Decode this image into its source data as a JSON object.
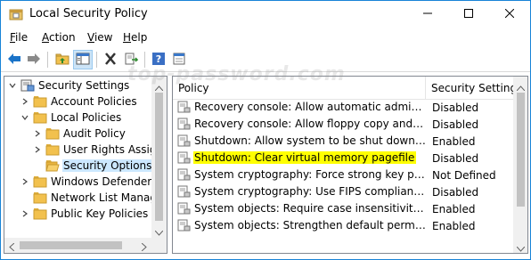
{
  "window": {
    "title": "Local Security Policy",
    "minimize_icon": "minimize-icon",
    "maximize_icon": "maximize-icon",
    "close_icon": "close-icon"
  },
  "menu": [
    {
      "label_ul": "F",
      "label_rest": "ile"
    },
    {
      "label_ul": "A",
      "label_rest": "ction"
    },
    {
      "label_ul": "V",
      "label_rest": "iew"
    },
    {
      "label_ul": "H",
      "label_rest": "elp"
    }
  ],
  "toolbar": {
    "buttons": [
      "back-icon",
      "forward-icon",
      "up-folder-icon",
      "show-hide-tree-icon",
      "delete-icon",
      "export-list-icon",
      "help-icon",
      "properties-icon"
    ]
  },
  "tree": {
    "items": [
      {
        "label": "Security Settings",
        "icon": "computer-policy-icon",
        "expanded": true
      },
      {
        "label": "Account Policies",
        "icon": "folder-icon",
        "expanded": false
      },
      {
        "label": "Local Policies",
        "icon": "folder-icon",
        "expanded": true
      },
      {
        "label": "Audit Policy",
        "icon": "folder-icon",
        "expanded": false
      },
      {
        "label": "User Rights Assignm",
        "icon": "folder-icon",
        "expanded": false
      },
      {
        "label": "Security Options",
        "icon": "folder-open-icon",
        "selected": true
      },
      {
        "label": "Windows Defender Fire",
        "icon": "folder-icon",
        "expanded": false
      },
      {
        "label": "Network List Manager P",
        "icon": "folder-icon"
      },
      {
        "label": "Public Key Policies",
        "icon": "folder-icon",
        "expanded": false
      }
    ]
  },
  "list": {
    "columns": [
      "Policy",
      "Security Setting"
    ],
    "rows": [
      {
        "policy": "Recovery console: Allow automatic administrati...",
        "setting": "Disabled"
      },
      {
        "policy": "Recovery console: Allow floppy copy and acces...",
        "setting": "Disabled"
      },
      {
        "policy": "Shutdown: Allow system to be shut down with...",
        "setting": "Enabled"
      },
      {
        "policy": "Shutdown: Clear virtual memory pagefile",
        "setting": "Disabled",
        "highlighted": true
      },
      {
        "policy": "System cryptography: Force strong key protecti...",
        "setting": "Not Defined"
      },
      {
        "policy": "System cryptography: Use FIPS compliant algor...",
        "setting": "Disabled"
      },
      {
        "policy": "System objects: Require case insensitivity for no...",
        "setting": "Enabled"
      },
      {
        "policy": "System objects: Strengthen default permissions...",
        "setting": "Enabled"
      }
    ]
  },
  "watermark": "top-password.com",
  "colors": {
    "accent_border": "#1883d7",
    "highlight": "#ffff00",
    "folder": "#f2c14e"
  }
}
